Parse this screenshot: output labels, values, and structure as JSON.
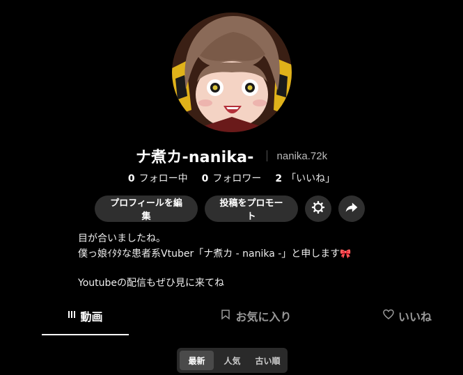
{
  "profile": {
    "display_name": "ナ煮カ-nanika-",
    "username": "nanika.72k",
    "stats": [
      {
        "value": "0",
        "label": "フォロー中"
      },
      {
        "value": "0",
        "label": "フォロワー"
      },
      {
        "value": "2",
        "label": "「いいね」"
      }
    ]
  },
  "actions": {
    "edit_label": "プロフィールを編集",
    "promote_label": "投稿をプロモート",
    "settings_icon": "gear-icon",
    "share_icon": "share-arrow-icon"
  },
  "bio": {
    "line1": "目が合いましたね。",
    "line2": "僕っ娘ｲﾀﾀな患者系Vtuber「ナ煮カ - nanika -」と申します",
    "line2_emoji": "🎀",
    "line3": "Youtubeの配信もぜひ見に来てね"
  },
  "tabs": [
    {
      "label": "動画",
      "icon": "grid-lines-icon"
    },
    {
      "label": "お気に入り",
      "icon": "bookmark-icon"
    },
    {
      "label": "いいね",
      "icon": "heart-icon"
    }
  ],
  "sort": {
    "options": [
      "最新",
      "人気",
      "古い順"
    ],
    "selected": "最新"
  },
  "colors": {
    "background": "#000000",
    "button_bg": "#2f2f2f",
    "accent_bow": "#c2185b"
  }
}
